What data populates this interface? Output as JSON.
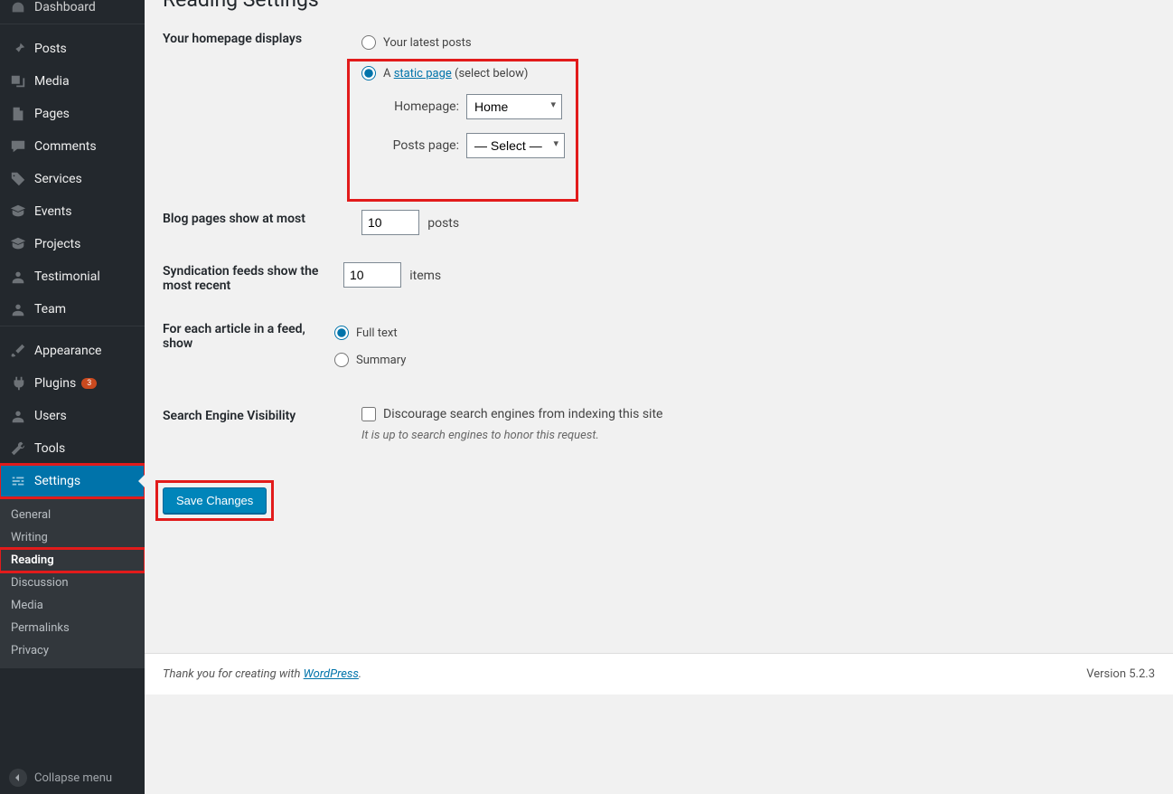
{
  "page": {
    "title": "Reading Settings"
  },
  "sidebar": {
    "items": [
      {
        "label": "Dashboard"
      },
      {
        "label": "Posts"
      },
      {
        "label": "Media"
      },
      {
        "label": "Pages"
      },
      {
        "label": "Comments"
      },
      {
        "label": "Services"
      },
      {
        "label": "Events"
      },
      {
        "label": "Projects"
      },
      {
        "label": "Testimonial"
      },
      {
        "label": "Team"
      },
      {
        "label": "Appearance"
      },
      {
        "label": "Plugins",
        "badge": "3"
      },
      {
        "label": "Users"
      },
      {
        "label": "Tools"
      },
      {
        "label": "Settings"
      }
    ],
    "submenu": [
      "General",
      "Writing",
      "Reading",
      "Discussion",
      "Media",
      "Permalinks",
      "Privacy"
    ],
    "collapse": "Collapse menu"
  },
  "homepage": {
    "heading": "Your homepage displays",
    "opt_latest": "Your latest posts",
    "opt_static_prefix": "A ",
    "opt_static_link": "static page",
    "opt_static_suffix": " (select below)",
    "homepage_label": "Homepage:",
    "homepage_value": "Home",
    "postspage_label": "Posts page:",
    "postspage_value": "— Select —"
  },
  "blogpages": {
    "heading": "Blog pages show at most",
    "value": "10",
    "suffix": "posts"
  },
  "syndication": {
    "heading": "Syndication feeds show the most recent",
    "value": "10",
    "suffix": "items"
  },
  "feed": {
    "heading": "For each article in a feed, show",
    "opt_full": "Full text",
    "opt_summary": "Summary"
  },
  "sev": {
    "heading": "Search Engine Visibility",
    "checkbox_label": "Discourage search engines from indexing this site",
    "note": "It is up to search engines to honor this request."
  },
  "submit": {
    "label": "Save Changes"
  },
  "footer": {
    "thanks_prefix": "Thank you for creating with ",
    "wp": "WordPress",
    "thanks_suffix": ".",
    "version": "Version 5.2.3"
  }
}
